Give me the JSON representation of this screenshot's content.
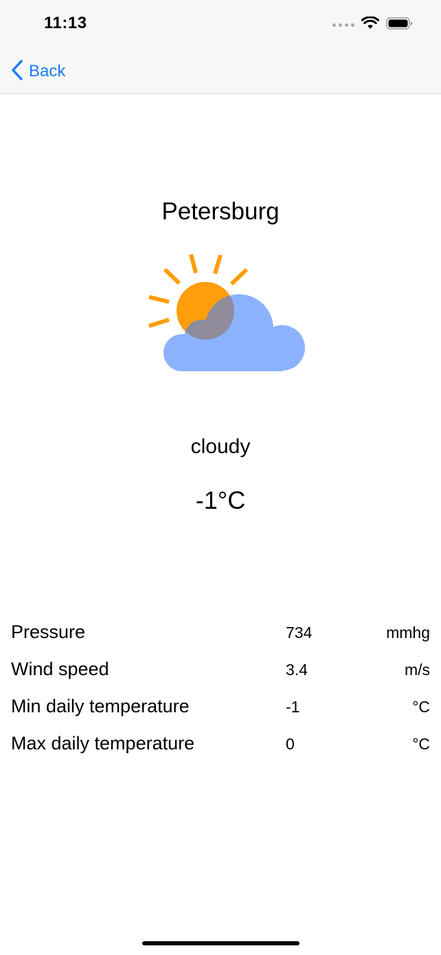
{
  "status_bar": {
    "time": "11:13",
    "icons": [
      "signal-dots-icon",
      "wifi-icon",
      "battery-icon"
    ]
  },
  "nav_bar": {
    "back_label": "Back",
    "back_icon": "chevron-left-icon",
    "accent_color": "#1a7cf2"
  },
  "weather": {
    "city": "Petersburg",
    "icon": "partly-cloudy-icon",
    "condition": "cloudy",
    "temperature": "-1°C",
    "colors": {
      "sun": "#ff9d0a",
      "cloud": "#8cb2fd",
      "overlap": "#8f8b9b"
    }
  },
  "details": [
    {
      "label": "Pressure",
      "value": "734",
      "unit": "mmhg"
    },
    {
      "label": "Wind speed",
      "value": "3.4",
      "unit": "m/s"
    },
    {
      "label": "Min daily temperature",
      "value": "-1",
      "unit": "°C"
    },
    {
      "label": "Max daily temperature",
      "value": "0",
      "unit": "°C"
    }
  ]
}
